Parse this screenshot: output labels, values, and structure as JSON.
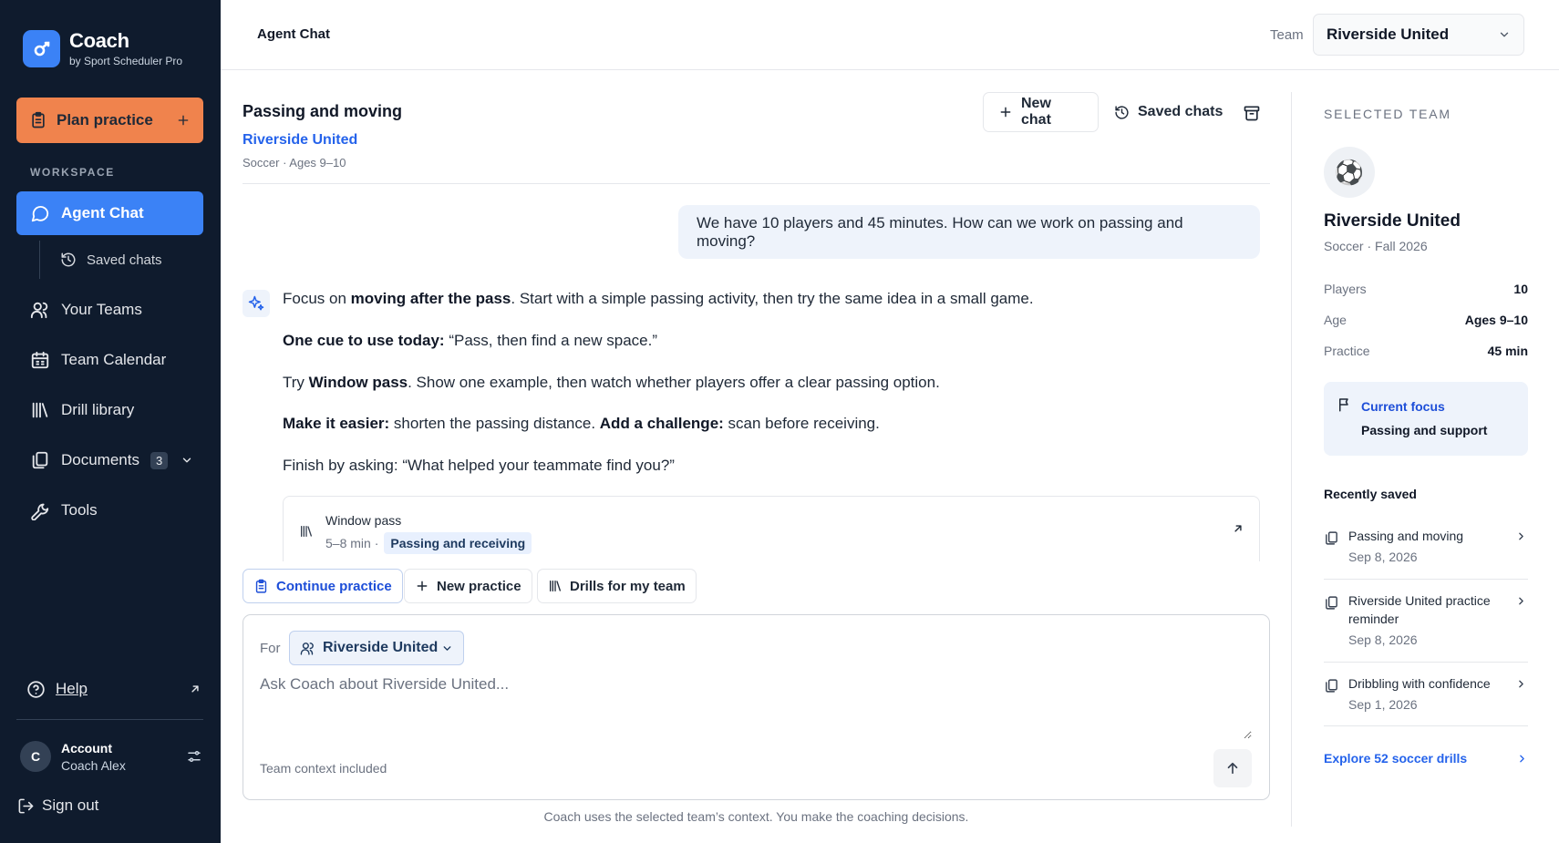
{
  "brand": {
    "name": "Coach",
    "subtitle": "by Sport Scheduler Pro"
  },
  "sidebar": {
    "plan_button": "Plan practice",
    "section_label": "WORKSPACE",
    "items": [
      {
        "label": "Agent Chat",
        "icon": "chat-bubble-icon",
        "active": true
      },
      {
        "label": "Saved chats",
        "icon": "history-icon"
      },
      {
        "label": "Your Teams",
        "icon": "users-icon"
      },
      {
        "label": "Team Calendar",
        "icon": "calendar-icon"
      },
      {
        "label": "Drill library",
        "icon": "library-icon"
      },
      {
        "label": "Documents",
        "icon": "documents-icon",
        "badge": "3"
      },
      {
        "label": "Tools",
        "icon": "wrench-icon"
      }
    ],
    "help": "Help",
    "account": {
      "title": "Account",
      "name": "Coach Alex",
      "initial": "C"
    },
    "sign_out": "Sign out"
  },
  "topbar": {
    "title": "Agent Chat",
    "team_label": "Team",
    "team_value": "Riverside United"
  },
  "chat": {
    "title": "Passing and moving",
    "team": "Riverside United",
    "meta": "Soccer · Ages 9–10",
    "new_chat": "New chat",
    "saved_chats": "Saved chats",
    "user_message": "We have 10 players and 45 minutes. How can we work on passing and moving?",
    "agent": {
      "l1_pre": "Focus on ",
      "l1_bold": "moving after the pass",
      "l1_post": ". Start with a simple passing activity, then try the same idea in a small game.",
      "l2_bold": "One cue to use today:",
      "l2_post": " “Pass, then find a new space.”",
      "l3_pre": "Try ",
      "l3_bold": "Window pass",
      "l3_post": ". Show one example, then watch whether players offer a clear passing option.",
      "l4_bold1": "Make it easier:",
      "l4_mid": " shorten the passing distance. ",
      "l4_bold2": "Add a challenge:",
      "l4_post": " scan before receiving.",
      "l5": "Finish by asking: “What helped your teammate find you?”"
    },
    "drill_card": {
      "name": "Window pass",
      "duration": "5–8 min ·",
      "tag": "Passing and receiving"
    },
    "quick_actions": [
      "Continue practice",
      "New practice",
      "Drills for my team"
    ],
    "composer": {
      "for_label": "For",
      "for_value": "Riverside United",
      "placeholder": "Ask Coach about Riverside United...",
      "context_note": "Team context included"
    },
    "disclaimer": "Coach uses the selected team’s context. You make the coaching decisions."
  },
  "panel": {
    "label": "SELECTED TEAM",
    "emblem": "⚽",
    "team": "Riverside United",
    "meta": "Soccer · Fall 2026",
    "stats": [
      {
        "k": "Players",
        "v": "10"
      },
      {
        "k": "Age",
        "v": "Ages 9–10"
      },
      {
        "k": "Practice",
        "v": "45 min"
      }
    ],
    "focus": {
      "title": "Current focus",
      "value": "Passing and support"
    },
    "recent_label": "Recently saved",
    "recent": [
      {
        "title": "Passing and moving",
        "date": "Sep 8, 2026"
      },
      {
        "title": "Riverside United practice reminder",
        "date": "Sep 8, 2026"
      },
      {
        "title": "Dribbling with confidence",
        "date": "Sep 1, 2026"
      }
    ],
    "explore": "Explore 52 soccer drills"
  },
  "colors": {
    "sidebar_bg": "#0f1b2d",
    "accent": "#3b82f6",
    "plan_orange": "#f0834d",
    "link_blue": "#2563eb"
  }
}
